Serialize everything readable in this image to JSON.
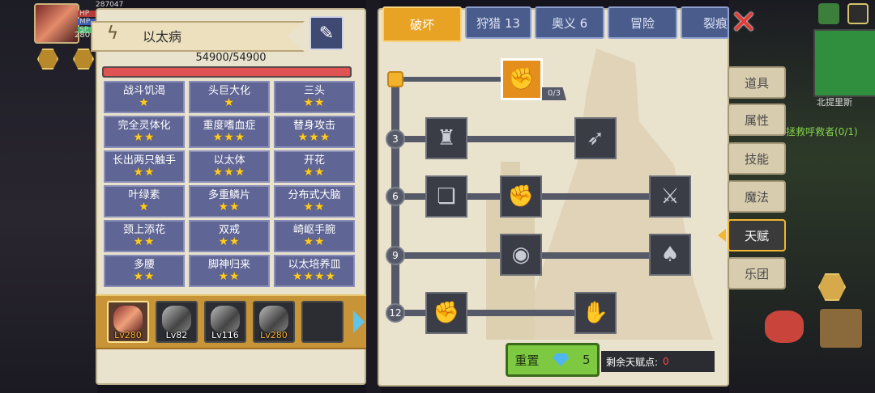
{
  "player": {
    "stat_power": "287047",
    "hp_label": "HP",
    "mp_label": "MP",
    "sp_label": "SP",
    "level": "280"
  },
  "left_panel": {
    "enemy_name": "以太病",
    "hp_text": "54900/54900",
    "hp_fraction": 1.0,
    "traits": [
      {
        "label": "战斗饥渴",
        "stars": "★"
      },
      {
        "label": "头巨大化",
        "stars": "★"
      },
      {
        "label": "三头",
        "stars": "★★"
      },
      {
        "label": "完全灵体化",
        "stars": "★★"
      },
      {
        "label": "重度嗜血症",
        "stars": "★★★"
      },
      {
        "label": "替身攻击",
        "stars": "★★★"
      },
      {
        "label": "长出两只触手",
        "stars": "★★"
      },
      {
        "label": "以太体",
        "stars": "★★★"
      },
      {
        "label": "开花",
        "stars": "★★"
      },
      {
        "label": "叶绿素",
        "stars": "★"
      },
      {
        "label": "多重鳞片",
        "stars": "★★"
      },
      {
        "label": "分布式大脑",
        "stars": "★★"
      },
      {
        "label": "颈上添花",
        "stars": "★★"
      },
      {
        "label": "双戒",
        "stars": "★★"
      },
      {
        "label": "崎岖手腕",
        "stars": "★★"
      },
      {
        "label": "多腰",
        "stars": "★★"
      },
      {
        "label": "脚神归来",
        "stars": "★★"
      },
      {
        "label": "以太培养皿",
        "stars": "★★★★"
      }
    ],
    "heroes": [
      {
        "level": "Lv280",
        "selected": true
      },
      {
        "level": "Lv82",
        "selected": false
      },
      {
        "level": "Lv116",
        "selected": false
      },
      {
        "level": "Lv280",
        "selected": false
      },
      {
        "level": "",
        "selected": false
      }
    ]
  },
  "tabs": [
    {
      "label": "破坏",
      "active": true
    },
    {
      "label": "狩猎 13",
      "active": false
    },
    {
      "label": "奥义 6",
      "active": false
    },
    {
      "label": "冒险",
      "active": false
    },
    {
      "label": "裂痕",
      "active": false
    }
  ],
  "talent_tree": {
    "root_talent_count": "0/3",
    "tiers": [
      "3",
      "6",
      "9",
      "12"
    ],
    "icons": {
      "root": "arm-wrestle-icon",
      "t3": [
        "muscle-body-icon",
        "arrow-strike-icon"
      ],
      "t6": [
        "card-shield-icon",
        "fist-punch-icon",
        "claw-slash-icon"
      ],
      "t9": [
        "ripple-orb-icon",
        "bat-wing-icon"
      ],
      "t12": [
        "raised-fist-icon",
        "wrapped-fist-icon"
      ]
    }
  },
  "reset": {
    "label": "重置",
    "cost": "5"
  },
  "remaining": {
    "label": "剩余天赋点:",
    "value": "0"
  },
  "side_tabs": [
    {
      "label": "道具",
      "active": false
    },
    {
      "label": "属性",
      "active": false
    },
    {
      "label": "技能",
      "active": false
    },
    {
      "label": "魔法",
      "active": false
    },
    {
      "label": "天赋",
      "active": true
    },
    {
      "label": "乐团",
      "active": false
    }
  ],
  "world": {
    "map_name": "北提里斯",
    "quest": "拯救呼救者(0/1)"
  },
  "colors": {
    "active_tab": "#e8a325",
    "tab": "#4a5c8c",
    "reset_button": "#7ec942",
    "hp_fill": "#e05353",
    "trait_cell": "#5f6594"
  }
}
